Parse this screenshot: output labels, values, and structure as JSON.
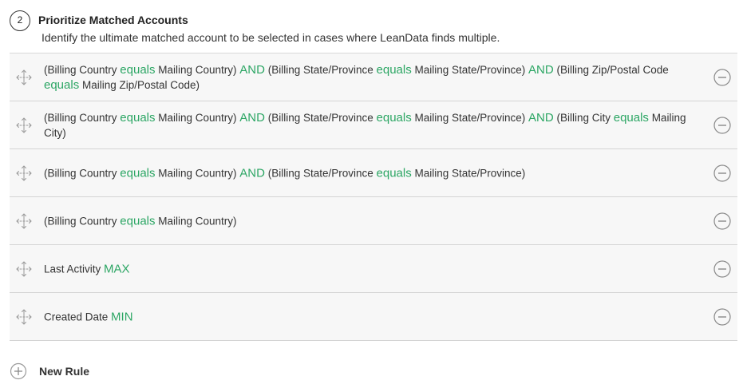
{
  "section": {
    "step_number": "2",
    "title": "Prioritize Matched Accounts",
    "subtitle": "Identify the ultimate matched account to be selected in cases where LeanData finds multiple."
  },
  "rules": [
    {
      "segments": [
        {
          "text": "(Billing Country ",
          "kw": false
        },
        {
          "text": "equals",
          "kw": true
        },
        {
          "text": " Mailing Country) ",
          "kw": false
        },
        {
          "text": "AND",
          "kw": true
        },
        {
          "text": " (Billing State/Province ",
          "kw": false
        },
        {
          "text": "equals",
          "kw": true
        },
        {
          "text": " Mailing State/Province) ",
          "kw": false
        },
        {
          "text": "AND",
          "kw": true
        },
        {
          "text": " (Billing Zip/Postal Code ",
          "kw": false
        },
        {
          "text": "equals",
          "kw": true
        },
        {
          "text": " Mailing Zip/Postal Code)",
          "kw": false
        }
      ]
    },
    {
      "segments": [
        {
          "text": "(Billing Country ",
          "kw": false
        },
        {
          "text": "equals",
          "kw": true
        },
        {
          "text": " Mailing Country) ",
          "kw": false
        },
        {
          "text": "AND",
          "kw": true
        },
        {
          "text": " (Billing State/Province ",
          "kw": false
        },
        {
          "text": "equals",
          "kw": true
        },
        {
          "text": " Mailing State/Province) ",
          "kw": false
        },
        {
          "text": "AND",
          "kw": true
        },
        {
          "text": " (Billing City ",
          "kw": false
        },
        {
          "text": "equals",
          "kw": true
        },
        {
          "text": " Mailing City)",
          "kw": false
        }
      ]
    },
    {
      "segments": [
        {
          "text": "(Billing Country ",
          "kw": false
        },
        {
          "text": "equals",
          "kw": true
        },
        {
          "text": " Mailing Country) ",
          "kw": false
        },
        {
          "text": "AND",
          "kw": true
        },
        {
          "text": " (Billing State/Province ",
          "kw": false
        },
        {
          "text": "equals",
          "kw": true
        },
        {
          "text": " Mailing State/Province)",
          "kw": false
        }
      ]
    },
    {
      "segments": [
        {
          "text": "(Billing Country ",
          "kw": false
        },
        {
          "text": "equals",
          "kw": true
        },
        {
          "text": " Mailing Country)",
          "kw": false
        }
      ]
    },
    {
      "segments": [
        {
          "text": "Last Activity ",
          "kw": false
        },
        {
          "text": "MAX",
          "kw": true
        }
      ]
    },
    {
      "segments": [
        {
          "text": "Created Date ",
          "kw": false
        },
        {
          "text": "MIN",
          "kw": true
        }
      ]
    }
  ],
  "icons": {
    "drag": "move-arrows-icon",
    "remove": "minus-circle-icon",
    "add": "plus-circle-icon"
  },
  "new_rule_label": "New Rule",
  "colors": {
    "keyword": "#2ca664",
    "row_background": "#f7f7f7",
    "row_border": "#d4d4d4"
  }
}
